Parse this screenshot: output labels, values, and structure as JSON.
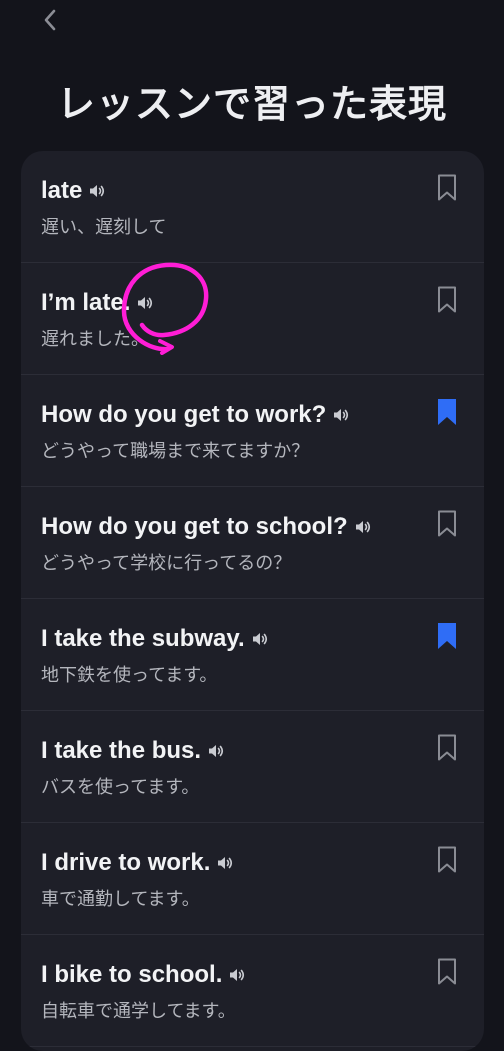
{
  "header": {
    "back_icon": "chevron-left-icon",
    "title": "レッスンで習った表現"
  },
  "colors": {
    "background": "#13141b",
    "card": "#1e1f28",
    "bookmark_active": "#2f6df6",
    "bookmark_inactive": "#8a8c94",
    "annotation": "#ff1dd6"
  },
  "items": [
    {
      "phrase": "late",
      "translation": "遅い、遅刻して",
      "bookmarked": false,
      "icon": "speaker-icon"
    },
    {
      "phrase": "I’m late.",
      "translation": "遅れました。",
      "bookmarked": false,
      "icon": "speaker-icon"
    },
    {
      "phrase": "How do you get to work?",
      "translation": "どうやって職場まで来てますか？",
      "bookmarked": true,
      "icon": "speaker-icon"
    },
    {
      "phrase": "How do you get to school?",
      "translation": "どうやって学校に行ってるの？",
      "bookmarked": false,
      "icon": "speaker-icon"
    },
    {
      "phrase": "I take the subway.",
      "translation": "地下鉄を使ってます。",
      "bookmarked": true,
      "icon": "speaker-icon"
    },
    {
      "phrase": "I take the bus.",
      "translation": "バスを使ってます。",
      "bookmarked": false,
      "icon": "speaker-icon"
    },
    {
      "phrase": "I drive to work.",
      "translation": "車で通勤してます。",
      "bookmarked": false,
      "icon": "speaker-icon"
    },
    {
      "phrase": "I bike to school.",
      "translation": "自転車で通学してます。",
      "bookmarked": false,
      "icon": "speaker-icon"
    }
  ]
}
